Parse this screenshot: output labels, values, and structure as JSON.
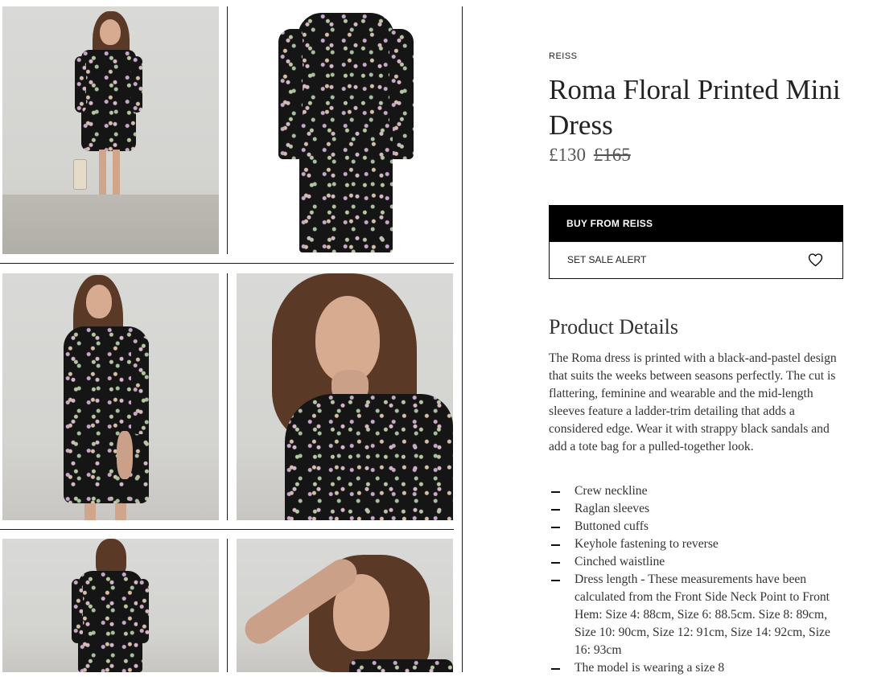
{
  "product": {
    "brand": "REISS",
    "title": "Roma Floral Printed Mini Dress",
    "price": "£130",
    "original_price": "£165"
  },
  "actions": {
    "buy_label": "BUY FROM REISS",
    "alert_label": "SET SALE ALERT",
    "alert_icon": "heart-icon"
  },
  "details": {
    "heading": "Product Details",
    "description": "The Roma dress is printed with a black-and-pastel design that suits the weeks between seasons perfectly. The cut is flattering, feminine and wearable and the mid-length sleeves feature a ladder-trim detailing that adds a considered edge. Wear it with strappy black sandals and add a tote bag for a pulled-together look.",
    "bullets": [
      "Crew neckline",
      "Raglan sleeves",
      "Buttoned cuffs",
      "Keyhole fastening to reverse",
      "Cinched waistline",
      "Dress length - These measurements have been calculated from the Front Side Neck Point to Front Hem: Size 4: 88cm, Size 6: 88.5cm. Size 8: 89cm, Size 10: 90cm, Size 12: 91cm, Size 14: 92cm, Size 16: 93cm",
      "The model is wearing a size 8"
    ]
  },
  "colors": {
    "button_bg": "#000000",
    "button_text": "#ffffff",
    "text": "#333333",
    "dress": "#151515"
  }
}
